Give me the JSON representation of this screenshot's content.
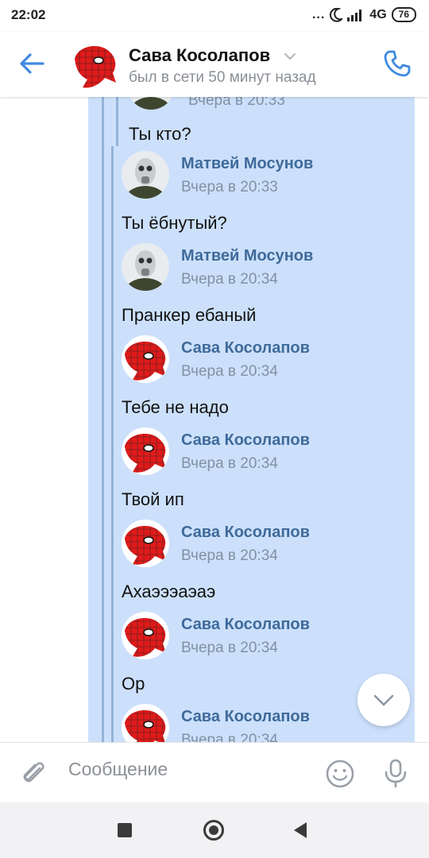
{
  "status_bar": {
    "time": "22:02",
    "dots": "...",
    "network": "4G",
    "battery": "76"
  },
  "header": {
    "contact_name": "Сава Косолапов",
    "contact_status": "был в сети 50 минут назад",
    "icons": [
      "back-arrow-icon",
      "chevron-down-icon",
      "phone-icon"
    ]
  },
  "messages": [
    {
      "author": "",
      "time": "Вчера в 20:33",
      "text": "Ты кто?",
      "avatar": "gasmask-avatar"
    },
    {
      "author": "Матвей Мосунов",
      "time": "Вчера в 20:33",
      "text": "Ты ёбнутый?",
      "avatar": "gasmask-avatar"
    },
    {
      "author": "Матвей Мосунов",
      "time": "Вчера в 20:34",
      "text": "Пранкер ебаный",
      "avatar": "gasmask-avatar"
    },
    {
      "author": "Сава Косолапов",
      "time": "Вчера в 20:34",
      "text": "Тебе не надо",
      "avatar": "spider-avatar"
    },
    {
      "author": "Сава Косолапов",
      "time": "Вчера в 20:34",
      "text": "Твой ип",
      "avatar": "spider-avatar"
    },
    {
      "author": "Сава Косолапов",
      "time": "Вчера в 20:34",
      "text": "Ахаэээаэаэ",
      "avatar": "spider-avatar"
    },
    {
      "author": "Сава Косолапов",
      "time": "Вчера в 20:34",
      "text": "Ор",
      "avatar": "spider-avatar"
    },
    {
      "author": "Сава Косолапов",
      "time": "Вчера в 20:34",
      "text": "",
      "avatar": "spider-avatar"
    }
  ],
  "composer": {
    "placeholder": "Сообщение",
    "icons": [
      "paperclip-icon",
      "emoji-icon",
      "microphone-icon"
    ]
  },
  "colors": {
    "accent": "#3f8ae0",
    "forward_background": "#cce0fb",
    "author_text": "#3f6a9a",
    "muted_text": "#8290a3"
  }
}
